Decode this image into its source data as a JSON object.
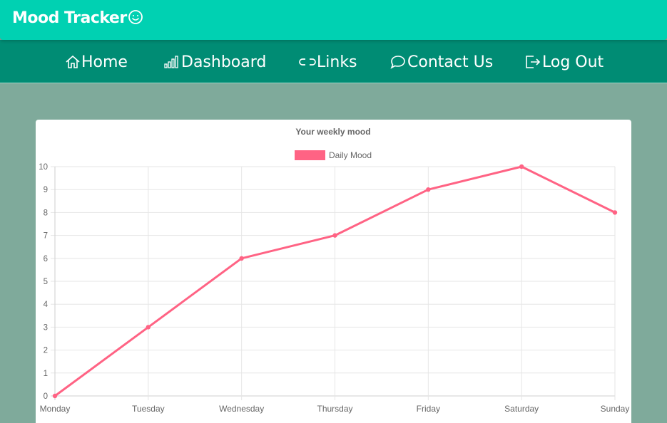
{
  "header": {
    "brand": "Mood Tracker",
    "brand_icon": "smile-icon"
  },
  "nav": [
    {
      "label": "Home",
      "icon": "home-icon"
    },
    {
      "label": "Dashboard",
      "icon": "bar-chart-icon"
    },
    {
      "label": "Links",
      "icon": "link-icon"
    },
    {
      "label": "Contact Us",
      "icon": "chat-icon"
    },
    {
      "label": "Log Out",
      "icon": "logout-icon"
    }
  ],
  "colors": {
    "topbar": "#00d1b2",
    "navbar": "#008c74",
    "background": "#7faa9b",
    "series": "#ff6384"
  },
  "chart_data": {
    "type": "line",
    "title": "Your weekly mood",
    "categories": [
      "Monday",
      "Tuesday",
      "Wednesday",
      "Thursday",
      "Friday",
      "Saturday",
      "Sunday"
    ],
    "series": [
      {
        "name": "Daily Mood",
        "values": [
          0,
          3,
          6,
          7,
          9,
          10,
          8
        ],
        "color": "#ff6384"
      }
    ],
    "ylim": [
      0,
      10
    ],
    "yticks": [
      "0",
      "1",
      "2",
      "3",
      "4",
      "5",
      "6",
      "7",
      "8",
      "9",
      "10"
    ],
    "xlabel": "",
    "ylabel": "",
    "grid": true,
    "legend": "top"
  }
}
